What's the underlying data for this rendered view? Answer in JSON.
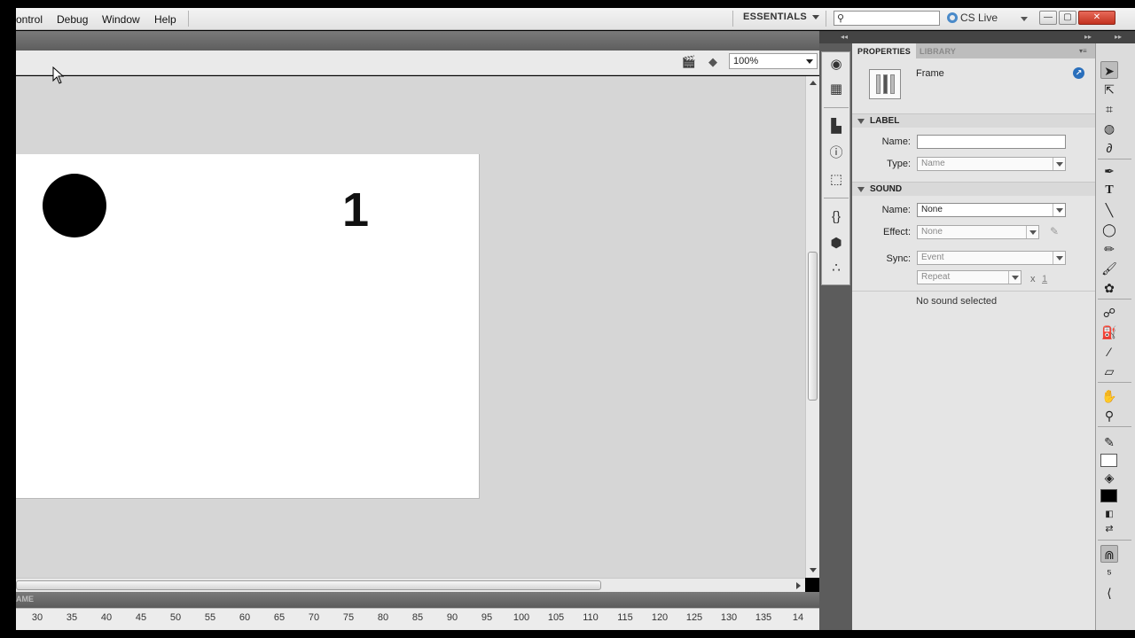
{
  "menu": {
    "items": [
      "ontrol",
      "Debug",
      "Window",
      "Help"
    ],
    "workspace": "ESSENTIALS",
    "search_placeholder": "",
    "cs_live": "CS Live"
  },
  "window_controls": {
    "minimize": "—",
    "maximize": "▢",
    "close": "✕"
  },
  "edit_bar": {
    "zoom": "100%"
  },
  "stage": {
    "frame_text": "1",
    "stage_color": "#ffffff",
    "ball_color": "#000000"
  },
  "timeline": {
    "tab_label": "AME",
    "ruler_ticks": [
      "30",
      "35",
      "40",
      "45",
      "50",
      "55",
      "60",
      "65",
      "70",
      "75",
      "80",
      "85",
      "90",
      "95",
      "100",
      "105",
      "110",
      "115",
      "120",
      "125",
      "130",
      "135",
      "14"
    ]
  },
  "properties": {
    "tabs": [
      "PROPERTIES",
      "LIBRARY"
    ],
    "object_type": "Frame",
    "help_glyph": "↗",
    "label_section": {
      "title": "LABEL",
      "name_label": "Name:",
      "name_value": "",
      "type_label": "Type:",
      "type_value": "Name"
    },
    "sound_section": {
      "title": "SOUND",
      "name_label": "Name:",
      "name_value": "None",
      "effect_label": "Effect:",
      "effect_value": "None",
      "sync_label": "Sync:",
      "sync_value": "Event",
      "repeat_value": "Repeat",
      "times_symbol": "x",
      "repeat_count": "1",
      "status": "No sound selected"
    }
  },
  "colors": {
    "accent": "#2a6fbc",
    "panel_dark": "#5c5c5c",
    "pasteboard": "#d6d6d6"
  }
}
